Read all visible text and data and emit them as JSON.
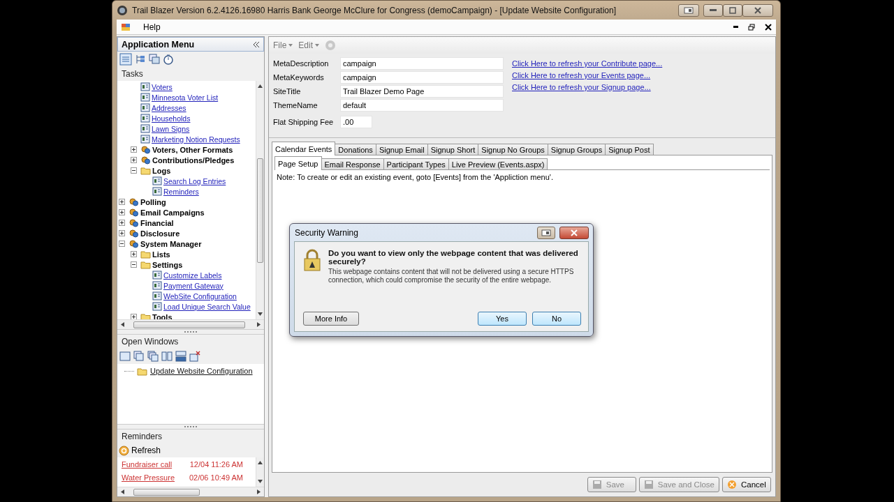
{
  "window": {
    "title": "Trail Blazer Version 6.2.4126.16980 Harris Bank George McClure for Congress (demoCampaign) - [Update Website Configuration]"
  },
  "menu": [
    "Help"
  ],
  "app_menu": {
    "title": "Application Menu",
    "section": "Tasks",
    "tree": {
      "scrolled_branch": [
        {
          "label": "Voters",
          "kind": "link"
        },
        {
          "label": "Minnesota Voter List",
          "kind": "link"
        },
        {
          "label": "Addresses",
          "kind": "link"
        },
        {
          "label": "Households",
          "kind": "link"
        },
        {
          "label": "Lawn Signs",
          "kind": "link"
        },
        {
          "label": "Marketing Notion Requests",
          "kind": "link"
        },
        {
          "label": "Voters, Other Formats",
          "kind": "group",
          "expanded": false
        },
        {
          "label": "Contributions/Pledges",
          "kind": "group",
          "expanded": false
        },
        {
          "label": "Logs",
          "kind": "folder",
          "expanded": true,
          "children": [
            {
              "label": "Search Log Entries",
              "kind": "link"
            },
            {
              "label": "Reminders",
              "kind": "link"
            }
          ]
        }
      ],
      "items": [
        {
          "label": "Polling",
          "kind": "group",
          "expanded": false
        },
        {
          "label": "Email Campaigns",
          "kind": "group",
          "expanded": false
        },
        {
          "label": "Financial",
          "kind": "group",
          "expanded": false
        },
        {
          "label": "Disclosure",
          "kind": "group",
          "expanded": false
        },
        {
          "label": "System Manager",
          "kind": "group",
          "expanded": true,
          "children": [
            {
              "label": "Lists",
              "kind": "folder",
              "expanded": false
            },
            {
              "label": "Settings",
              "kind": "folder",
              "expanded": true,
              "children": [
                {
                  "label": "Customize Labels",
                  "kind": "link"
                },
                {
                  "label": "Payment Gateway",
                  "kind": "link"
                },
                {
                  "label": "WebSite Configuration",
                  "kind": "link"
                },
                {
                  "label": "Load Unique Search Value",
                  "kind": "link"
                }
              ]
            },
            {
              "label": "Tools",
              "kind": "folder",
              "expanded": false
            }
          ]
        }
      ]
    }
  },
  "open_windows": {
    "title": "Open Windows",
    "items": [
      "Update Website Configuration"
    ]
  },
  "reminders": {
    "title": "Reminders",
    "refresh": "Refresh",
    "rows": [
      {
        "name": "Fundraiser call",
        "time": "12/04 11:26 AM"
      },
      {
        "name": "Water Pressure",
        "time": "02/06 10:49 AM"
      }
    ]
  },
  "toolbar": [
    "File",
    "Edit"
  ],
  "fields": [
    {
      "label": "MetaDescription",
      "value": "campaign"
    },
    {
      "label": "MetaKeywords",
      "value": "campaign"
    },
    {
      "label": "SiteTitle",
      "value": "Trail Blazer Demo Page"
    },
    {
      "label": "ThemeName",
      "value": "default"
    }
  ],
  "shipping": {
    "label": "Flat Shipping Fee",
    "value": ".00"
  },
  "links": [
    "Click Here to refresh your Contribute page...",
    "Click Here to refresh your Events page...",
    "Click Here to refresh your Signup page..."
  ],
  "tabs": [
    {
      "label": "Calendar Events",
      "selected": true
    },
    {
      "label": "Donations",
      "selected": false
    },
    {
      "label": "Signup Email",
      "selected": false
    },
    {
      "label": "Signup Short",
      "selected": false
    },
    {
      "label": "Signup No Groups",
      "selected": false
    },
    {
      "label": "Signup Groups",
      "selected": false
    },
    {
      "label": "Signup Post",
      "selected": false
    }
  ],
  "subtabs": [
    {
      "label": "Page Setup",
      "selected": true
    },
    {
      "label": "Email Response",
      "selected": false
    },
    {
      "label": "Participant Types",
      "selected": false
    },
    {
      "label": "Live Preview (Events.aspx)",
      "selected": false
    }
  ],
  "note": "Note: To create or edit an existing event, goto [Events] from the 'Appliction menu'.",
  "buttons": [
    {
      "label": "Save",
      "disabled": true
    },
    {
      "label": "Save and Close",
      "disabled": true
    },
    {
      "label": "Cancel",
      "disabled": false
    }
  ],
  "dialog": {
    "title": "Security Warning",
    "heading": "Do you want to view only the webpage content that was delivered securely?",
    "body": "This webpage contains content that will not be delivered using a secure HTTPS connection, which could compromise the security of the entire webpage.",
    "buttons": [
      {
        "label": "More Info",
        "kind": "secondary"
      },
      {
        "label": "Yes",
        "kind": "primary"
      },
      {
        "label": "No",
        "kind": "primary"
      }
    ]
  }
}
